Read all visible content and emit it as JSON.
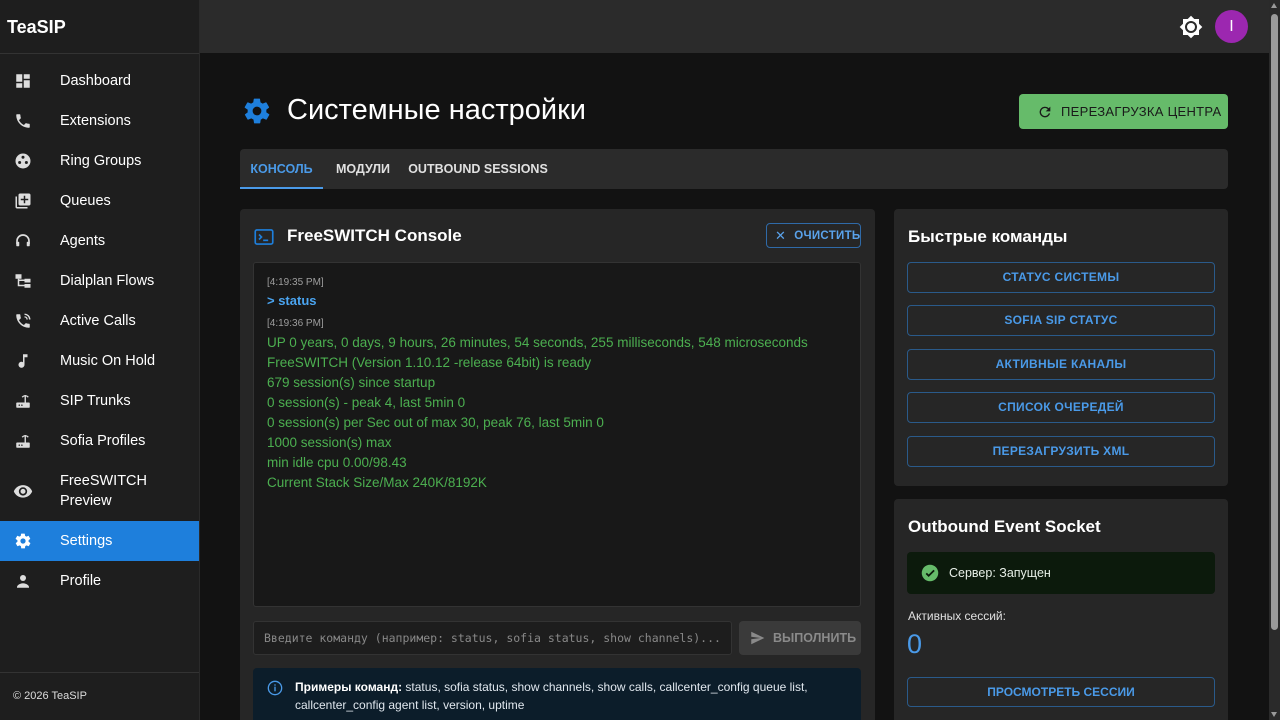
{
  "app": {
    "brand": "TeaSIP",
    "footer": "© 2026 TeaSIP",
    "avatar_initial": "I"
  },
  "colors": {
    "accent": "#1e7fdc",
    "success": "#66bb6a",
    "avatar": "#9c27b0",
    "console_text": "#4caf50"
  },
  "sidebar": {
    "items": [
      {
        "label": "Dashboard",
        "icon": "dashboard-icon"
      },
      {
        "label": "Extensions",
        "icon": "phone-icon"
      },
      {
        "label": "Ring Groups",
        "icon": "ring-groups-icon"
      },
      {
        "label": "Queues",
        "icon": "queue-icon"
      },
      {
        "label": "Agents",
        "icon": "headset-icon"
      },
      {
        "label": "Dialplan Flows",
        "icon": "flow-icon"
      },
      {
        "label": "Active Calls",
        "icon": "phone-in-talk-icon"
      },
      {
        "label": "Music On Hold",
        "icon": "music-note-icon"
      },
      {
        "label": "SIP Trunks",
        "icon": "router-icon"
      },
      {
        "label": "Sofia Profiles",
        "icon": "router-icon"
      },
      {
        "label": "FreeSWITCH",
        "label2": "Preview",
        "icon": "eye-icon"
      },
      {
        "label": "Settings",
        "icon": "gear-icon",
        "active": true
      },
      {
        "label": "Profile",
        "icon": "person-icon"
      }
    ]
  },
  "header": {
    "title": "Системные настройки",
    "reload_label": "ПЕРЕЗАГРУЗКА ЦЕНТРА"
  },
  "tabs": [
    {
      "label": "КОНСОЛЬ",
      "active": true
    },
    {
      "label": "МОДУЛИ"
    },
    {
      "label": "OUTBOUND SESSIONS"
    }
  ],
  "console": {
    "title": "FreeSWITCH Console",
    "clear_label": "ОЧИСТИТЬ",
    "entries": [
      {
        "time": "[4:19:35 PM]",
        "command": "> status"
      },
      {
        "time": "[4:19:36 PM]"
      }
    ],
    "output": [
      "UP 0 years, 0 days, 9 hours, 26 minutes, 54 seconds, 255 milliseconds, 548 microseconds",
      "FreeSWITCH (Version 1.10.12 -release 64bit) is ready",
      "679 session(s) since startup",
      "0 session(s) - peak 4, last 5min 0",
      "0 session(s) per Sec out of max 30, peak 76, last 5min 0",
      "1000 session(s) max",
      "min idle cpu 0.00/98.43",
      "Current Stack Size/Max 240K/8192K"
    ],
    "input_placeholder": "Введите команду (например: status, sofia status, show channels)...",
    "run_label": "ВЫПОЛНИТЬ",
    "examples_label": "Примеры команд:",
    "examples_line1": "status, sofia status, show channels, show calls, callcenter_config queue list,",
    "examples_line2": "callcenter_config agent list, version, uptime"
  },
  "quick": {
    "title": "Быстрые команды",
    "buttons": [
      "СТАТУС СИСТЕМЫ",
      "SOFIA SIP СТАТУС",
      "АКТИВНЫЕ КАНАЛЫ",
      "СПИСОК ОЧЕРЕДЕЙ",
      "ПЕРЕЗАГРУЗИТЬ XML"
    ]
  },
  "socket": {
    "title": "Outbound Event Socket",
    "status": "Сервер: Запущен",
    "sessions_label": "Активных сессий:",
    "sessions_count": "0",
    "view_label": "ПРОСМОТРЕТЬ СЕССИИ"
  }
}
